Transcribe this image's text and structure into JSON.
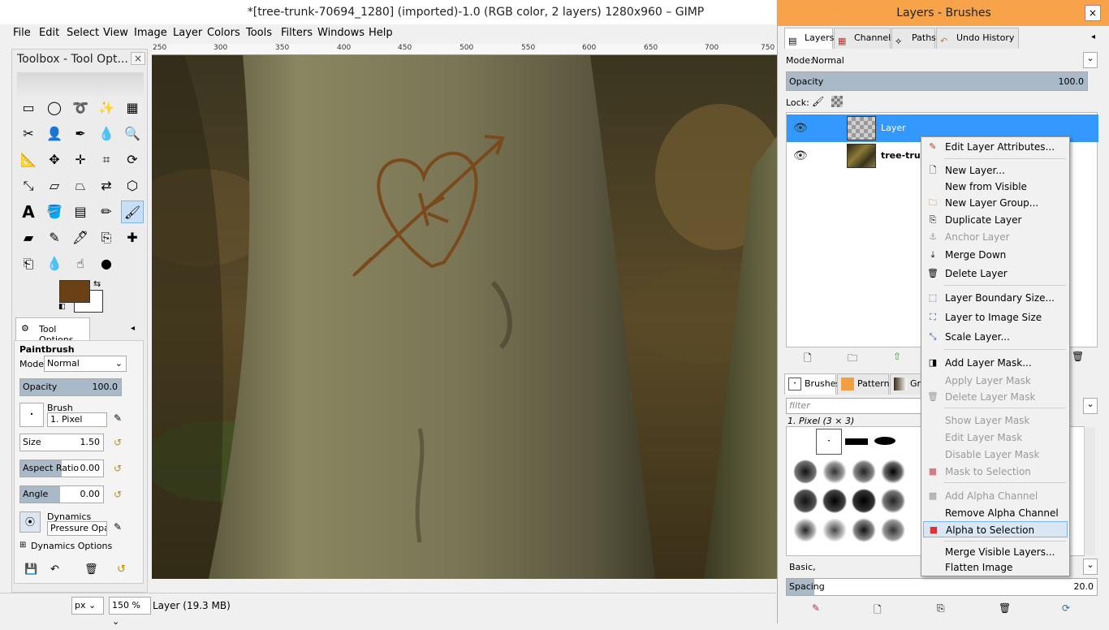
{
  "main": {
    "title": "*[tree-trunk-70694_1280] (imported)-1.0 (RGB color, 2 layers) 1280x960 – GIMP",
    "menus": [
      "File",
      "Edit",
      "Select",
      "View",
      "Image",
      "Layer",
      "Colors",
      "Tools",
      "Filters",
      "Windows",
      "Help"
    ],
    "ruler_ticks": [
      "250",
      "300",
      "350",
      "400",
      "450",
      "500",
      "550",
      "600",
      "650",
      "700",
      "750"
    ]
  },
  "toolbox": {
    "title": "Toolbox - Tool Opt...",
    "close": "×",
    "tool_options_tab": "Tool Options",
    "tool_name": "Paintbrush",
    "mode_label": "Mode:",
    "mode_value": "Normal",
    "opacity_label": "Opacity",
    "opacity_value": "100.0",
    "brush_label": "Brush",
    "brush_value": "1. Pixel",
    "size_label": "Size",
    "size_value": "1.50",
    "aspect_label": "Aspect Ratio",
    "aspect_value": "0.00",
    "angle_label": "Angle",
    "angle_value": "0.00",
    "dynamics_label": "Dynamics",
    "dynamics_value": "Pressure Opacity",
    "dynamics_options": "Dynamics Options",
    "colors": {
      "foreground": "#6b4014",
      "background": "#ffffff"
    }
  },
  "status": {
    "unit": "px",
    "zoom": "150 %",
    "layer_info": "Layer (19.3 MB)"
  },
  "dock": {
    "title": "Layers - Brushes",
    "close": "×",
    "tabs": [
      "Layers",
      "Channels",
      "Paths",
      "Undo History"
    ],
    "mode_label": "Mode:",
    "mode_value": "Normal",
    "opacity_label": "Opacity",
    "opacity_value": "100.0",
    "lock_label": "Lock:",
    "layers": [
      {
        "name": "Layer",
        "selected": true
      },
      {
        "name": "tree-trunk",
        "selected": false
      }
    ],
    "brush_tabs": [
      "Brushes",
      "Patterns",
      "Gra"
    ],
    "filter_placeholder": "filter",
    "brush_selected": "1. Pixel (3 × 3)",
    "brush_tag": "Basic,",
    "spacing_label": "Spacing",
    "spacing_value": "20.0"
  },
  "context_menu": {
    "items": [
      {
        "label": "Edit Layer Attributes...",
        "disabled": false,
        "icon": "pencil-icon"
      },
      {
        "label": "New Layer...",
        "disabled": false,
        "icon": "new-page-icon"
      },
      {
        "label": "New from Visible",
        "disabled": false,
        "icon": ""
      },
      {
        "label": "New Layer Group...",
        "disabled": false,
        "icon": "folder-icon"
      },
      {
        "label": "Duplicate Layer",
        "disabled": false,
        "icon": "duplicate-icon"
      },
      {
        "label": "Anchor Layer",
        "disabled": true,
        "icon": "anchor-icon"
      },
      {
        "label": "Merge Down",
        "disabled": false,
        "icon": "merge-icon"
      },
      {
        "label": "Delete Layer",
        "disabled": false,
        "icon": "trash-icon"
      },
      {
        "label": "Layer Boundary Size...",
        "disabled": false,
        "icon": "boundary-icon"
      },
      {
        "label": "Layer to Image Size",
        "disabled": false,
        "icon": "fit-icon"
      },
      {
        "label": "Scale Layer...",
        "disabled": false,
        "icon": "scale-icon"
      },
      {
        "label": "Add Layer Mask...",
        "disabled": false,
        "icon": "mask-add-icon"
      },
      {
        "label": "Apply Layer Mask",
        "disabled": true,
        "icon": ""
      },
      {
        "label": "Delete Layer Mask",
        "disabled": true,
        "icon": "trash-icon"
      },
      {
        "label": "Show Layer Mask",
        "disabled": true,
        "icon": ""
      },
      {
        "label": "Edit Layer Mask",
        "disabled": true,
        "icon": ""
      },
      {
        "label": "Disable Layer Mask",
        "disabled": true,
        "icon": ""
      },
      {
        "label": "Mask to Selection",
        "disabled": true,
        "icon": "mask-selection-icon"
      },
      {
        "label": "Add Alpha Channel",
        "disabled": true,
        "icon": "alpha-icon"
      },
      {
        "label": "Remove Alpha Channel",
        "disabled": false,
        "icon": ""
      },
      {
        "label": "Alpha to Selection",
        "disabled": false,
        "icon": "alpha-selection-icon"
      },
      {
        "label": "Merge Visible Layers...",
        "disabled": false,
        "icon": ""
      },
      {
        "label": "Flatten Image",
        "disabled": false,
        "icon": ""
      }
    ]
  }
}
